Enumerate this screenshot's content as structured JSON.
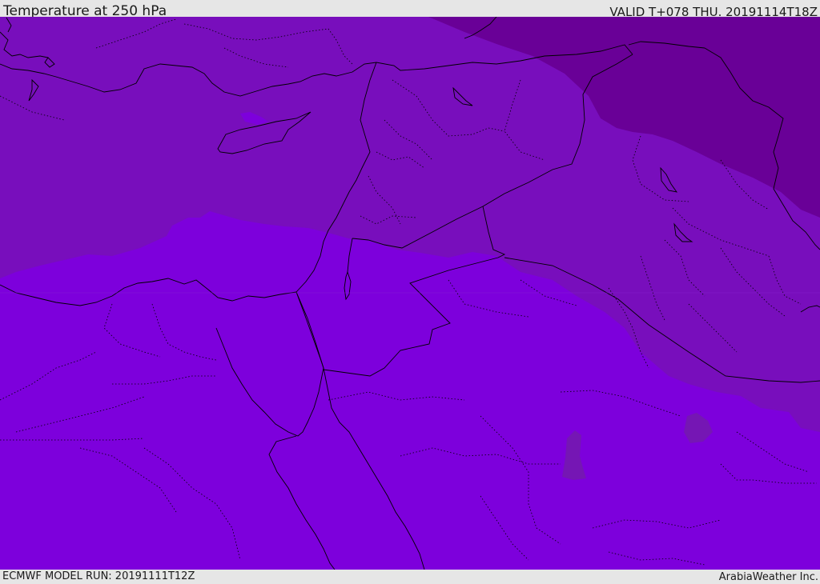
{
  "header": {
    "title": "Temperature at 250 hPa",
    "valid": "VALID T+078 THU. 20191114T18Z"
  },
  "footer": {
    "model_run": "ECMWF MODEL RUN: 20191111T12Z",
    "credit": "ArabiaWeather Inc."
  },
  "map": {
    "colors": {
      "band_warm": "#7d00dc",
      "band_mid": "#780ebc",
      "band_cold": "#690097",
      "cold_patch": "#7516b4",
      "border": "#000000"
    }
  }
}
